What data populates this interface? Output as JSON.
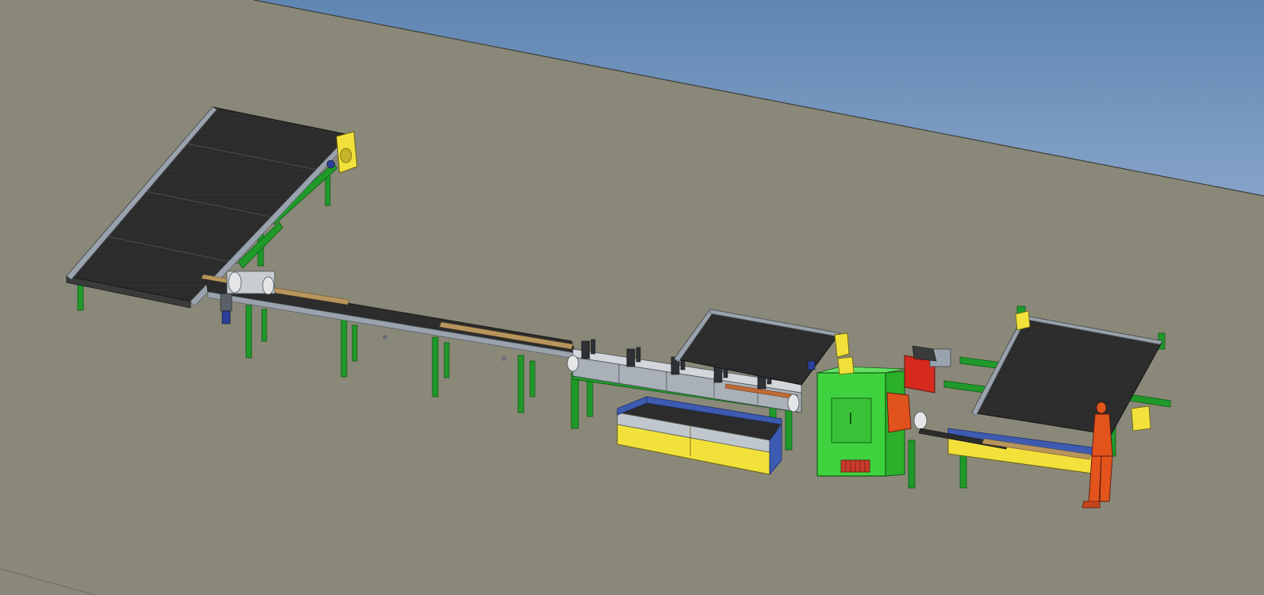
{
  "scene": {
    "description_visible_text": [],
    "colors": {
      "sky_top": "#5f86b2",
      "sky_bottom": "#7f9ec4",
      "floor": "#8a8878",
      "belt": "#2b2c2b",
      "belt_line": "#3d3e3d",
      "steel": "#9aa3ad",
      "steel_dark": "#5e666d",
      "frame_green": "#1f9a2a",
      "frame_green_dark": "#126a18",
      "machine_green": "#3fd23f",
      "safety_yellow": "#f2e13a",
      "guard_blue": "#3d5bb0",
      "motor_red": "#d62a1d",
      "operator_orange": "#e2541c",
      "wood": "#b8955c",
      "motor_blue": "#2a3f9c"
    },
    "components": [
      "infeed-belt-conveyor",
      "infeed-drive-motor-icon",
      "transfer-belt-conveyor",
      "roller-sorting-table",
      "yellow-catch-bin",
      "middle-belt-conveyor",
      "green-processing-machine",
      "red-motor-assembly",
      "outfeed-belt-conveyor",
      "operator-figure"
    ]
  }
}
